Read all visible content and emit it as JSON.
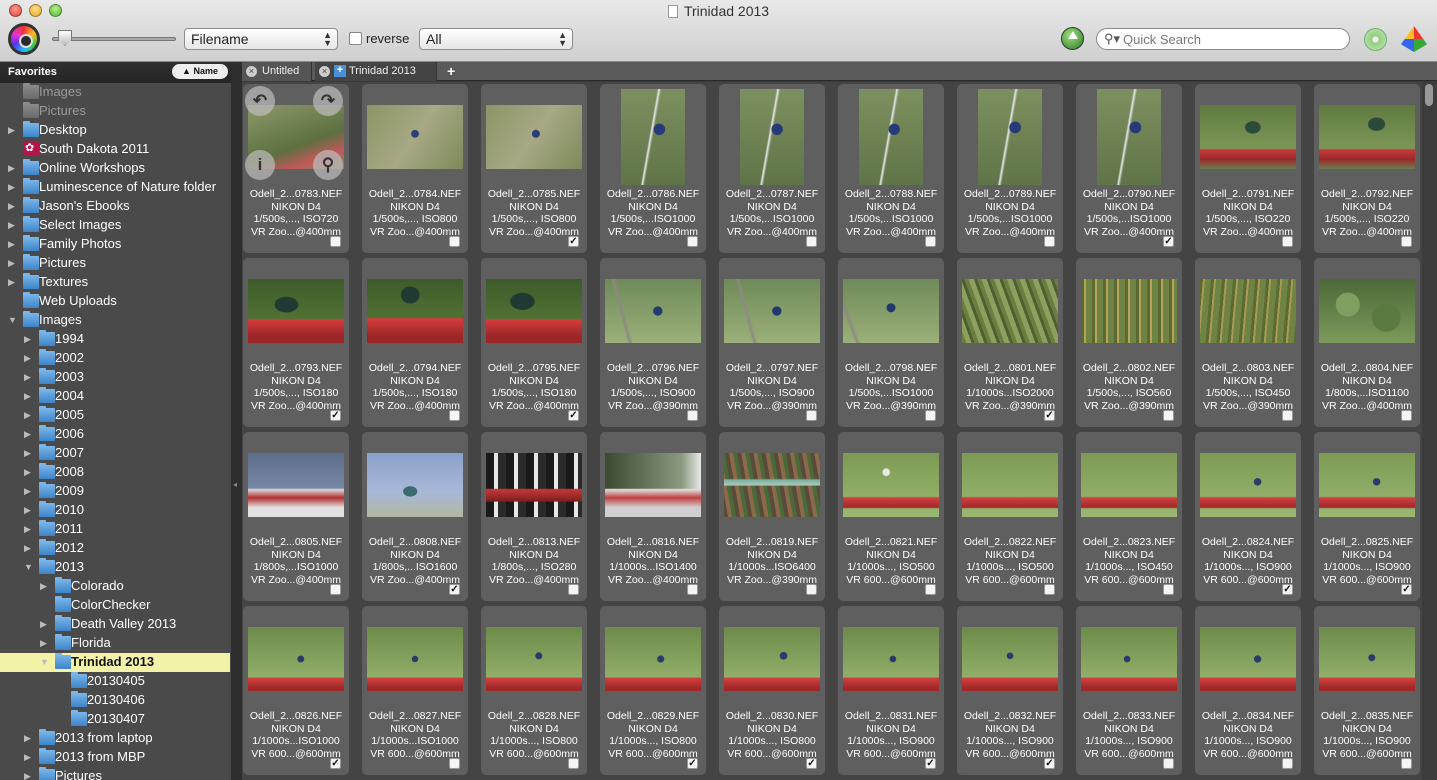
{
  "window": {
    "title": "Trinidad 2013"
  },
  "toolbar": {
    "sort_field": "Filename",
    "reverse_label": "reverse",
    "reverse_checked": false,
    "filter": "All",
    "search_placeholder": "Quick Search",
    "zoom_level": 0.05
  },
  "sidebar": {
    "header": "Favorites",
    "sort_button": "▲ Name",
    "items": [
      {
        "label": "Images",
        "depth": 0,
        "tw": "",
        "icon": "gray",
        "dim": true
      },
      {
        "label": "Pictures",
        "depth": 0,
        "tw": "",
        "icon": "gray",
        "dim": true
      },
      {
        "label": "Desktop",
        "depth": 0,
        "tw": "▶",
        "icon": "folder"
      },
      {
        "label": "South Dakota 2011",
        "depth": 0,
        "tw": "",
        "icon": "app"
      },
      {
        "label": "Online Workshops",
        "depth": 0,
        "tw": "▶",
        "icon": "folder"
      },
      {
        "label": "Luminescence of Nature folder",
        "depth": 0,
        "tw": "▶",
        "icon": "folder"
      },
      {
        "label": "Jason's Ebooks",
        "depth": 0,
        "tw": "▶",
        "icon": "folder"
      },
      {
        "label": "Select Images",
        "depth": 0,
        "tw": "▶",
        "icon": "folder"
      },
      {
        "label": "Family Photos",
        "depth": 0,
        "tw": "▶",
        "icon": "folder"
      },
      {
        "label": "Pictures",
        "depth": 0,
        "tw": "▶",
        "icon": "folder"
      },
      {
        "label": "Textures",
        "depth": 0,
        "tw": "▶",
        "icon": "folder"
      },
      {
        "label": "Web Uploads",
        "depth": 0,
        "tw": "",
        "icon": "folder"
      },
      {
        "label": "Images",
        "depth": 0,
        "tw": "▼",
        "icon": "folder"
      },
      {
        "label": "1994",
        "depth": 1,
        "tw": "▶",
        "icon": "folder"
      },
      {
        "label": "2002",
        "depth": 1,
        "tw": "▶",
        "icon": "folder"
      },
      {
        "label": "2003",
        "depth": 1,
        "tw": "▶",
        "icon": "folder"
      },
      {
        "label": "2004",
        "depth": 1,
        "tw": "▶",
        "icon": "folder"
      },
      {
        "label": "2005",
        "depth": 1,
        "tw": "▶",
        "icon": "folder"
      },
      {
        "label": "2006",
        "depth": 1,
        "tw": "▶",
        "icon": "folder"
      },
      {
        "label": "2007",
        "depth": 1,
        "tw": "▶",
        "icon": "folder"
      },
      {
        "label": "2008",
        "depth": 1,
        "tw": "▶",
        "icon": "folder"
      },
      {
        "label": "2009",
        "depth": 1,
        "tw": "▶",
        "icon": "folder"
      },
      {
        "label": "2010",
        "depth": 1,
        "tw": "▶",
        "icon": "folder"
      },
      {
        "label": "2011",
        "depth": 1,
        "tw": "▶",
        "icon": "folder"
      },
      {
        "label": "2012",
        "depth": 1,
        "tw": "▶",
        "icon": "folder"
      },
      {
        "label": "2013",
        "depth": 1,
        "tw": "▼",
        "icon": "folder"
      },
      {
        "label": "Colorado",
        "depth": 2,
        "tw": "▶",
        "icon": "folder"
      },
      {
        "label": "ColorChecker",
        "depth": 2,
        "tw": "",
        "icon": "folder"
      },
      {
        "label": "Death Valley 2013",
        "depth": 2,
        "tw": "▶",
        "icon": "folder"
      },
      {
        "label": "Florida",
        "depth": 2,
        "tw": "▶",
        "icon": "folder"
      },
      {
        "label": "Trinidad 2013",
        "depth": 2,
        "tw": "▼",
        "icon": "folder",
        "selected": true
      },
      {
        "label": "20130405",
        "depth": 3,
        "tw": "",
        "icon": "folder"
      },
      {
        "label": "20130406",
        "depth": 3,
        "tw": "",
        "icon": "folder"
      },
      {
        "label": "20130407",
        "depth": 3,
        "tw": "",
        "icon": "folder"
      },
      {
        "label": "2013 from laptop",
        "depth": 1,
        "tw": "▶",
        "icon": "folder"
      },
      {
        "label": "2013 from MBP",
        "depth": 1,
        "tw": "▶",
        "icon": "folder"
      },
      {
        "label": "Pictures",
        "depth": 1,
        "tw": "▶",
        "icon": "folder"
      }
    ]
  },
  "tabs": [
    {
      "label": "Untitled",
      "active": false
    },
    {
      "label": "Trinidad 2013",
      "active": true
    }
  ],
  "overlay_icons": [
    "rotate-left-icon",
    "rotate-right-icon",
    "info-icon",
    "zoom-icon"
  ],
  "thumbnails": [
    {
      "file": "Odell_2...0783.NEF",
      "camera": "NIKON D4",
      "exposure": "1/500s,..., ISO720",
      "lens": "VR Zoo...@400mm",
      "checked": false,
      "orient": "l",
      "bg": "linear-gradient(160deg,#8c9a6a,#5e7040 60%,#c0585a 80%,#7d8c60)"
    },
    {
      "file": "Odell_2...0784.NEF",
      "camera": "NIKON D4",
      "exposure": "1/500s,..., ISO800",
      "lens": "VR Zoo...@400mm",
      "checked": false,
      "orient": "l",
      "bg": "radial-gradient(circle at 50% 45%,#2a3f7a 0 6%,transparent 7%),linear-gradient(125deg,#8a9566,#a8a885 50%,#7c8a5a)"
    },
    {
      "file": "Odell_2...0785.NEF",
      "camera": "NIKON D4",
      "exposure": "1/500s,..., ISO800",
      "lens": "VR Zoo...@400mm",
      "checked": true,
      "orient": "l",
      "bg": "radial-gradient(circle at 52% 45%,#2a3f7a 0 6%,transparent 7%),linear-gradient(125deg,#8a9566,#a8a885 50%,#7c8a5a)"
    },
    {
      "file": "Odell_2...0786.NEF",
      "camera": "NIKON D4",
      "exposure": "1/500s,...ISO1000",
      "lens": "VR Zoo...@400mm",
      "checked": false,
      "orient": "p",
      "bg": "radial-gradient(circle at 60% 42%,#263a78 0 8%,transparent 9%),linear-gradient(100deg,transparent 45%,#e6e6e6 47%,transparent 50%),linear-gradient(#7d9060,#5f7448)"
    },
    {
      "file": "Odell_2...0787.NEF",
      "camera": "NIKON D4",
      "exposure": "1/500s,...ISO1000",
      "lens": "VR Zoo...@400mm",
      "checked": false,
      "orient": "p",
      "bg": "radial-gradient(circle at 58% 42%,#263a78 0 8%,transparent 9%),linear-gradient(100deg,transparent 45%,#e6e6e6 47%,transparent 50%),linear-gradient(#7d9060,#5f7448)"
    },
    {
      "file": "Odell_2...0788.NEF",
      "camera": "NIKON D4",
      "exposure": "1/500s,...ISO1000",
      "lens": "VR Zoo...@400mm",
      "checked": false,
      "orient": "p",
      "bg": "radial-gradient(circle at 55% 42%,#263a78 0 8%,transparent 9%),linear-gradient(100deg,transparent 45%,#e6e6e6 47%,transparent 50%),linear-gradient(#7d9060,#5f7448)"
    },
    {
      "file": "Odell_2...0789.NEF",
      "camera": "NIKON D4",
      "exposure": "1/500s,...ISO1000",
      "lens": "VR Zoo...@400mm",
      "checked": false,
      "orient": "p",
      "bg": "radial-gradient(circle at 58% 40%,#263a78 0 8%,transparent 9%),linear-gradient(100deg,transparent 45%,#e6e6e6 47%,transparent 50%),linear-gradient(#7d9060,#5f7448)"
    },
    {
      "file": "Odell_2...0790.NEF",
      "camera": "NIKON D4",
      "exposure": "1/500s,...ISO1000",
      "lens": "VR Zoo...@400mm",
      "checked": true,
      "orient": "p",
      "bg": "radial-gradient(circle at 60% 40%,#263a78 0 8%,transparent 9%),linear-gradient(100deg,transparent 45%,#e6e6e6 47%,transparent 50%),linear-gradient(#7d9060,#5f7448)"
    },
    {
      "file": "Odell_2...0791.NEF",
      "camera": "NIKON D4",
      "exposure": "1/500s,..., ISO220",
      "lens": "VR Zoo...@400mm",
      "checked": false,
      "orient": "l",
      "bg": "radial-gradient(ellipse at 55% 35%,#2c4a3c 0 10%,transparent 11%),linear-gradient(transparent 68%,#c83a3a 70%,#9a2a2a 85%,#6b7d50),linear-gradient(#5f7a3f,#8aa463)"
    },
    {
      "file": "Odell_2...0792.NEF",
      "camera": "NIKON D4",
      "exposure": "1/500s,..., ISO220",
      "lens": "VR Zoo...@400mm",
      "checked": false,
      "orient": "l",
      "bg": "radial-gradient(ellipse at 60% 30%,#2c4a3c 0 10%,transparent 11%),linear-gradient(transparent 68%,#c83a3a 70%,#9a2a2a 85%,#6b7d50),linear-gradient(#5f7a3f,#8aa463)"
    },
    {
      "file": "Odell_2...0793.NEF",
      "camera": "NIKON D4",
      "exposure": "1/500s,..., ISO180",
      "lens": "VR Zoo...@400mm",
      "checked": true,
      "orient": "l",
      "bg": "radial-gradient(ellipse at 40% 40%,#1f3a33 0 14%,transparent 15%),linear-gradient(transparent 62%,#d23c3c 64%,#9a2626 90%),linear-gradient(#3d5a2a,#5e7f3a)"
    },
    {
      "file": "Odell_2...0794.NEF",
      "camera": "NIKON D4",
      "exposure": "1/500s,..., ISO180",
      "lens": "VR Zoo...@400mm",
      "checked": false,
      "orient": "l",
      "bg": "radial-gradient(ellipse at 45% 25%,#1f3a33 0 12%,transparent 13%),linear-gradient(transparent 60%,#d23c3c 62%,#9a2626 90%),linear-gradient(#3d5a2a,#5e7f3a)"
    },
    {
      "file": "Odell_2...0795.NEF",
      "camera": "NIKON D4",
      "exposure": "1/500s,..., ISO180",
      "lens": "VR Zoo...@400mm",
      "checked": true,
      "orient": "l",
      "bg": "radial-gradient(ellipse at 38% 35%,#1f3a33 0 14%,transparent 15%),linear-gradient(transparent 62%,#d23c3c 64%,#9a2626 90%),linear-gradient(#3d5a2a,#5e7f3a)"
    },
    {
      "file": "Odell_2...0796.NEF",
      "camera": "NIKON D4",
      "exposure": "1/500s,..., ISO900",
      "lens": "VR Zoo...@390mm",
      "checked": false,
      "orient": "l",
      "bg": "radial-gradient(circle at 55% 50%,#223a70 0 7%,transparent 8%),linear-gradient(75deg,transparent 20%,#8d8a80 22%,transparent 25%),linear-gradient(#6f8a58,#9bb07a)"
    },
    {
      "file": "Odell_2...0797.NEF",
      "camera": "NIKON D4",
      "exposure": "1/500s,..., ISO900",
      "lens": "VR Zoo...@390mm",
      "checked": false,
      "orient": "l",
      "bg": "radial-gradient(circle at 55% 50%,#223a70 0 7%,transparent 8%),linear-gradient(75deg,transparent 25%,#8d8a80 27%,transparent 30%),linear-gradient(#6f8a58,#9bb07a)"
    },
    {
      "file": "Odell_2...0798.NEF",
      "camera": "NIKON D4",
      "exposure": "1/500s,...ISO1000",
      "lens": "VR Zoo...@390mm",
      "checked": false,
      "orient": "l",
      "bg": "radial-gradient(circle at 50% 45%,#223a70 0 7%,transparent 8%),linear-gradient(70deg,transparent 10%,#8d8a80 12%,transparent 15%),linear-gradient(#6f8a58,#9bb07a)"
    },
    {
      "file": "Odell_2...0801.NEF",
      "camera": "NIKON D4",
      "exposure": "1/1000s...ISO2000",
      "lens": "VR Zoo...@390mm",
      "checked": true,
      "orient": "l",
      "bg": "repeating-linear-gradient(70deg,#6b7d40 0 4px,#8da060 4px 9px,#4f6030 9px 12px)"
    },
    {
      "file": "Odell_2...0802.NEF",
      "camera": "NIKON D4",
      "exposure": "1/500s,..., ISO560",
      "lens": "VR Zoo...@390mm",
      "checked": false,
      "orient": "l",
      "bg": "repeating-linear-gradient(90deg,#5a6a30 0 3px,#b8a35a 3px 5px,#6f8444 5px 11px)"
    },
    {
      "file": "Odell_2...0803.NEF",
      "camera": "NIKON D4",
      "exposure": "1/500s,..., ISO450",
      "lens": "VR Zoo...@390mm",
      "checked": false,
      "orient": "l",
      "bg": "repeating-linear-gradient(95deg,#5a6a30 0 3px,#a89a55 3px 5px,#6f8444 5px 11px)"
    },
    {
      "file": "Odell_2...0804.NEF",
      "camera": "NIKON D4",
      "exposure": "1/800s,...ISO1100",
      "lens": "VR Zoo...@400mm",
      "checked": false,
      "orient": "l",
      "bg": "radial-gradient(circle at 30% 40%,#7fa060 0 15%,transparent 16%),radial-gradient(circle at 70% 60%,#5a7a40 0 18%,transparent 19%),linear-gradient(#4d6838,#7d9a5a)"
    },
    {
      "file": "Odell_2...0805.NEF",
      "camera": "NIKON D4",
      "exposure": "1/800s,...ISO1000",
      "lens": "VR Zoo...@400mm",
      "checked": false,
      "orient": "l",
      "bg": "linear-gradient(transparent 55%,#d8d8d8 57%,#b03030 70%,#e0e0e0 85%),linear-gradient(#5d6e8c,#8d9cb8)"
    },
    {
      "file": "Odell_2...0808.NEF",
      "camera": "NIKON D4",
      "exposure": "1/800s,...ISO1600",
      "lens": "VR Zoo...@400mm",
      "checked": true,
      "orient": "l",
      "bg": "radial-gradient(ellipse at 45% 60%,#3a6a70 0 9%,transparent 10%),linear-gradient(#8aa0c8,#a8b8d8 60%,#b0b8a0)"
    },
    {
      "file": "Odell_2...0813.NEF",
      "camera": "NIKON D4",
      "exposure": "1/800s,..., ISO280",
      "lens": "VR Zoo...@400mm",
      "checked": false,
      "orient": "l",
      "bg": "linear-gradient(transparent 55%,#c23838 57%,#802020 75%,transparent 77%),repeating-linear-gradient(90deg,#1a1a1a 0 8px,#e8e8e8 8px 12px,#2a2a2a 12px 20px)"
    },
    {
      "file": "Odell_2...0816.NEF",
      "camera": "NIKON D4",
      "exposure": "1/1000s...ISO1400",
      "lens": "VR Zoo...@400mm",
      "checked": false,
      "orient": "l",
      "bg": "linear-gradient(transparent 55%,#e0e0e0 57%,#c04040 70%,#d0d0d0 85%),linear-gradient(90deg,#3a4a30,#8a9a80 80%,#e8e8e8)"
    },
    {
      "file": "Odell_2...0819.NEF",
      "camera": "NIKON D4",
      "exposure": "1/1000s...ISO6400",
      "lens": "VR Zoo...@390mm",
      "checked": false,
      "orient": "l",
      "bg": "linear-gradient(transparent 40%,#7ab0a0 42%,#a8c8b8 50%,transparent 52%),repeating-linear-gradient(80deg,#5a4a3a 0 4px,#8a6a4a 4px 8px,#4a6a3a 8px 12px)"
    },
    {
      "file": "Odell_2...0821.NEF",
      "camera": "NIKON D4",
      "exposure": "1/1000s..., ISO500",
      "lens": "VR 600...@600mm",
      "checked": false,
      "orient": "l",
      "bg": "radial-gradient(circle at 45% 30%,#e8e8e8 0 5%,transparent 6%),linear-gradient(transparent 68%,#d24040 70%,#a02828 85%,transparent 87%),linear-gradient(#7d9a55,#9ab872)"
    },
    {
      "file": "Odell_2...0822.NEF",
      "camera": "NIKON D4",
      "exposure": "1/1000s..., ISO500",
      "lens": "VR 600...@600mm",
      "checked": false,
      "orient": "l",
      "bg": "linear-gradient(transparent 68%,#d24040 70%,#a02828 85%,transparent 87%),linear-gradient(#7d9a55,#9ab872)"
    },
    {
      "file": "Odell_2...0823.NEF",
      "camera": "NIKON D4",
      "exposure": "1/1000s..., ISO450",
      "lens": "VR 600...@600mm",
      "checked": false,
      "orient": "l",
      "bg": "linear-gradient(transparent 68%,#d24040 70%,#a02828 85%,transparent 87%),linear-gradient(#7d9a55,#9ab872)"
    },
    {
      "file": "Odell_2...0824.NEF",
      "camera": "NIKON D4",
      "exposure": "1/1000s..., ISO900",
      "lens": "VR 600...@600mm",
      "checked": true,
      "orient": "l",
      "bg": "radial-gradient(circle at 60% 45%,#2a3a6a 0 5%,transparent 6%),linear-gradient(transparent 68%,#d24040 70%,#a02828 85%,transparent 87%),linear-gradient(#7d9a55,#9ab872)"
    },
    {
      "file": "Odell_2...0825.NEF",
      "camera": "NIKON D4",
      "exposure": "1/1000s..., ISO900",
      "lens": "VR 600...@600mm",
      "checked": true,
      "orient": "l",
      "bg": "radial-gradient(circle at 60% 45%,#2a3a6a 0 5%,transparent 6%),linear-gradient(transparent 68%,#d24040 70%,#a02828 85%,transparent 87%),linear-gradient(#7d9a55,#9ab872)"
    },
    {
      "file": "Odell_2...0826.NEF",
      "camera": "NIKON D4",
      "exposure": "1/1000s...ISO1000",
      "lens": "VR 600...@600mm",
      "checked": true,
      "orient": "l",
      "bg": "radial-gradient(circle at 55% 50%,#2a3a6a 0 5%,transparent 6%),linear-gradient(transparent 78%,#d24040 80%,#a02828 95%),linear-gradient(#6d8a4a,#9ab872)"
    },
    {
      "file": "Odell_2...0827.NEF",
      "camera": "NIKON D4",
      "exposure": "1/1000s...ISO1000",
      "lens": "VR 600...@600mm",
      "checked": false,
      "orient": "l",
      "bg": "radial-gradient(circle at 50% 50%,#2a3a6a 0 5%,transparent 6%),linear-gradient(transparent 78%,#d24040 80%,#a02828 95%),linear-gradient(#6d8a4a,#9ab872)"
    },
    {
      "file": "Odell_2...0828.NEF",
      "camera": "NIKON D4",
      "exposure": "1/1000s..., ISO800",
      "lens": "VR 600...@600mm",
      "checked": false,
      "orient": "l",
      "bg": "radial-gradient(circle at 55% 45%,#2a3a6a 0 5%,transparent 6%),linear-gradient(transparent 78%,#d24040 80%,#a02828 95%),linear-gradient(#6d8a4a,#9ab872)"
    },
    {
      "file": "Odell_2...0829.NEF",
      "camera": "NIKON D4",
      "exposure": "1/1000s..., ISO800",
      "lens": "VR 600...@600mm",
      "checked": true,
      "orient": "l",
      "bg": "radial-gradient(circle at 58% 50%,#2a3a6a 0 5%,transparent 6%),linear-gradient(transparent 78%,#d24040 80%,#a02828 95%),linear-gradient(#6d8a4a,#9ab872)"
    },
    {
      "file": "Odell_2...0830.NEF",
      "camera": "NIKON D4",
      "exposure": "1/1000s..., ISO800",
      "lens": "VR 600...@600mm",
      "checked": true,
      "orient": "l",
      "bg": "radial-gradient(circle at 62% 45%,#2a3a6a 0 5%,transparent 6%),linear-gradient(transparent 78%,#d24040 80%,#a02828 95%),linear-gradient(#6d8a4a,#9ab872)"
    },
    {
      "file": "Odell_2...0831.NEF",
      "camera": "NIKON D4",
      "exposure": "1/1000s..., ISO900",
      "lens": "VR 600...@600mm",
      "checked": true,
      "orient": "l",
      "bg": "radial-gradient(circle at 52% 50%,#2a3a6a 0 5%,transparent 6%),linear-gradient(transparent 78%,#d24040 80%,#a02828 95%),linear-gradient(#6d8a4a,#9ab872)"
    },
    {
      "file": "Odell_2...0832.NEF",
      "camera": "NIKON D4",
      "exposure": "1/1000s..., ISO900",
      "lens": "VR 600...@600mm",
      "checked": true,
      "orient": "l",
      "bg": "radial-gradient(circle at 50% 45%,#2a3a6a 0 5%,transparent 6%),linear-gradient(transparent 78%,#d24040 80%,#a02828 95%),linear-gradient(#6d8a4a,#9ab872)"
    },
    {
      "file": "Odell_2...0833.NEF",
      "camera": "NIKON D4",
      "exposure": "1/1000s..., ISO900",
      "lens": "VR 600...@600mm",
      "checked": false,
      "orient": "l",
      "bg": "radial-gradient(circle at 48% 50%,#2a3a6a 0 5%,transparent 6%),linear-gradient(transparent 78%,#d24040 80%,#a02828 95%),linear-gradient(#6d8a4a,#9ab872)"
    },
    {
      "file": "Odell_2...0834.NEF",
      "camera": "NIKON D4",
      "exposure": "1/1000s..., ISO900",
      "lens": "VR 600...@600mm",
      "checked": false,
      "orient": "l",
      "bg": "radial-gradient(circle at 60% 50%,#2a3a6a 0 5%,transparent 6%),linear-gradient(transparent 78%,#d24040 80%,#a02828 95%),linear-gradient(#6d8a4a,#9ab872)"
    },
    {
      "file": "Odell_2...0835.NEF",
      "camera": "NIKON D4",
      "exposure": "1/1000s..., ISO900",
      "lens": "VR 600...@600mm",
      "checked": false,
      "orient": "l",
      "bg": "radial-gradient(circle at 55% 48%,#2a3a6a 0 5%,transparent 6%),linear-gradient(transparent 78%,#d24040 80%,#a02828 95%),linear-gradient(#6d8a4a,#9ab872)"
    }
  ]
}
